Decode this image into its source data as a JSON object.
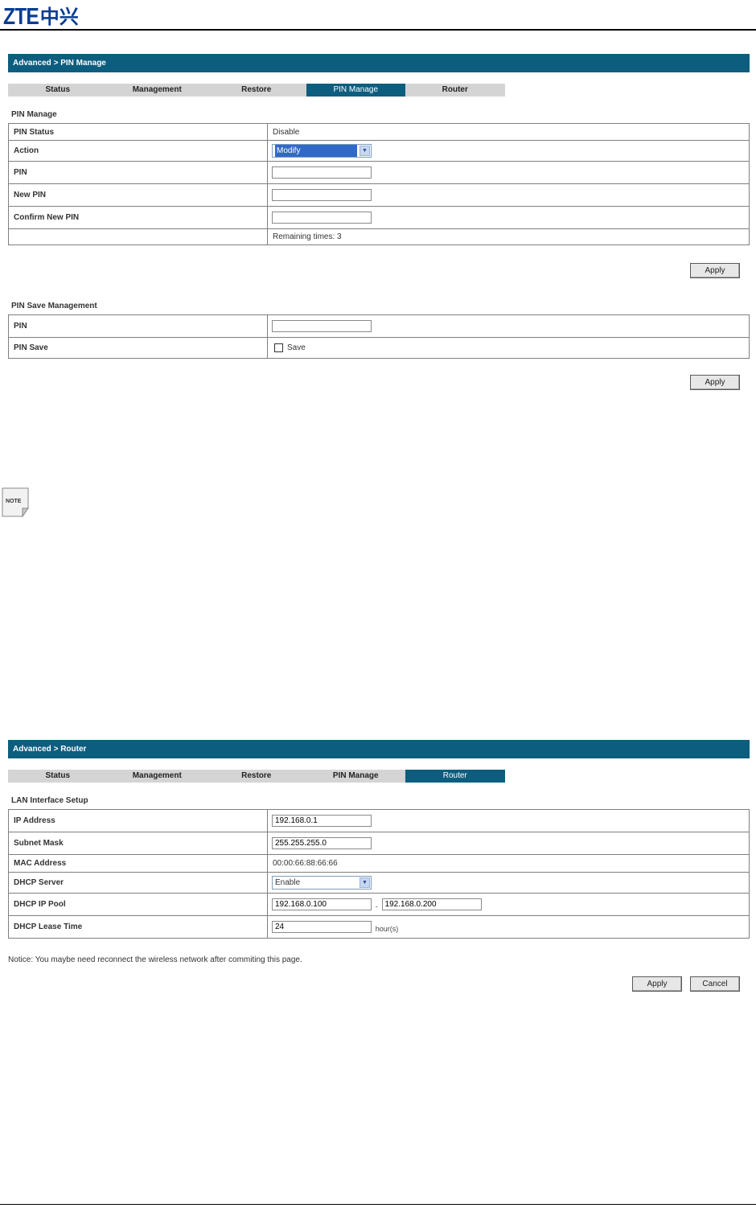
{
  "logo": {
    "latin": "ZTE",
    "chinese": "中兴"
  },
  "tab_labels": [
    "Status",
    "Management",
    "Restore",
    "PIN Manage",
    "Router"
  ],
  "pin_page": {
    "breadcrumb": "Advanced > PIN Manage",
    "active_tab": "PIN Manage",
    "section_title": "PIN Manage",
    "rows": {
      "pin_status_label": "PIN Status",
      "pin_status_value": "Disable",
      "action_label": "Action",
      "action_selected": "Modify",
      "pin_label": "PIN",
      "new_pin_label": "New PIN",
      "confirm_new_pin_label": "Confirm New PIN",
      "remaining": "Remaining times: 3"
    },
    "apply_label": "Apply",
    "save_section_title": "PIN Save Management",
    "save_rows": {
      "pin_label": "PIN",
      "pin_save_label": "PIN Save",
      "save_checkbox_label": "Save",
      "save_checked": false
    },
    "save_apply_label": "Apply"
  },
  "note_icon": {
    "icon": "note-icon",
    "text": "NOTE"
  },
  "router_page": {
    "breadcrumb": "Advanced > Router",
    "active_tab": "Router",
    "section_title": "LAN Interface Setup",
    "rows": {
      "ip_label": "IP Address",
      "ip_value": "192.168.0.1",
      "subnet_label": "Subnet Mask",
      "subnet_value": "255.255.255.0",
      "mac_label": "MAC Address",
      "mac_value": "00:00:66:88:66:66",
      "dhcp_server_label": "DHCP Server",
      "dhcp_server_selected": "Enable",
      "dhcp_pool_label": "DHCP IP Pool",
      "dhcp_pool_start": "192.168.0.100",
      "dhcp_pool_separator": "-",
      "dhcp_pool_end": "192.168.0.200",
      "lease_label": "DHCP Lease Time",
      "lease_value": "24",
      "lease_unit": "hour(s)"
    },
    "notice": "Notice: You maybe need reconnect the wireless network after commiting this page.",
    "apply_label": "Apply",
    "cancel_label": "Cancel"
  }
}
